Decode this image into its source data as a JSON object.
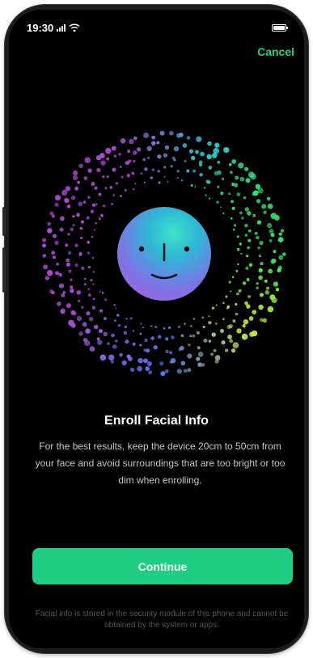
{
  "status_bar": {
    "time": "19:30"
  },
  "header": {
    "cancel_label": "Cancel"
  },
  "main": {
    "title": "Enroll Facial Info",
    "description": "For the best results, keep the device 20cm to 50cm from your face and avoid surroundings that are too bright or too dim when enrolling.",
    "continue_label": "Continue",
    "footer_note": "Facial info is stored in the security module of this phone and cannot be obtained by the system or apps."
  },
  "colors": {
    "accent": "#1fce83",
    "background": "#000000",
    "dot_gradient": [
      "#3be06a",
      "#2ac7d8",
      "#5b7cf2",
      "#b24ad8",
      "#c8e83a"
    ]
  },
  "icons": {
    "signal": "signal-icon",
    "wifi": "wifi-icon",
    "battery": "battery-icon",
    "face": "face-icon"
  }
}
